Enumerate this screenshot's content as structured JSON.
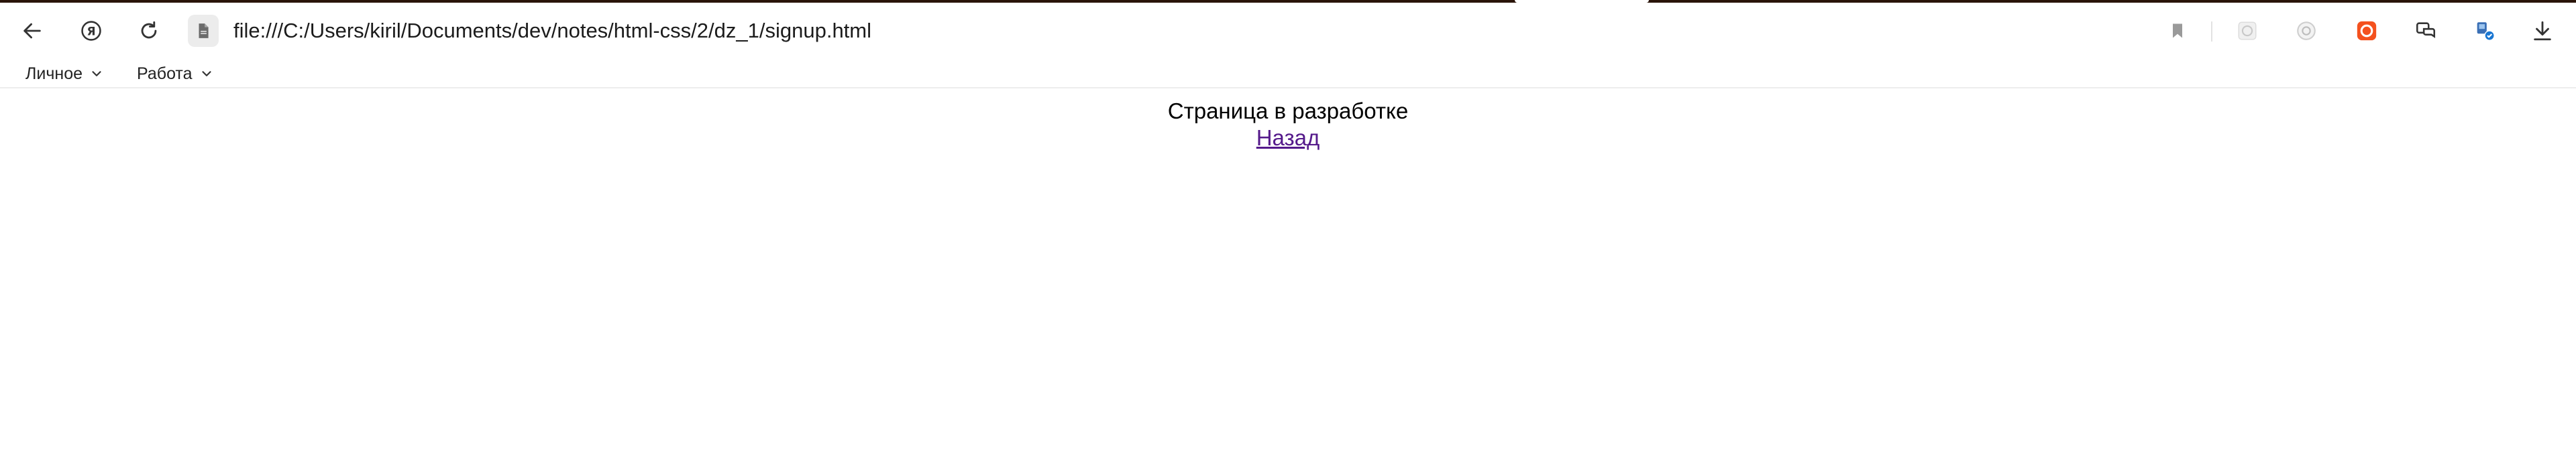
{
  "browser": {
    "address": "file:///C:/Users/kiril/Documents/dev/notes/html-css/2/dz_1/signup.html",
    "bookmarks": [
      {
        "label": "Личное",
        "icon": "chevron-down-icon"
      },
      {
        "label": "Работа",
        "icon": "chevron-down-icon"
      }
    ],
    "toolbar_icons": [
      "back-arrow-icon",
      "yandex-logo-icon",
      "reload-icon",
      "file-icon",
      "bookmark-icon",
      "extension-icons",
      "download-icon"
    ]
  },
  "page": {
    "heading": "Страница в разработке",
    "link": "Назад"
  }
}
